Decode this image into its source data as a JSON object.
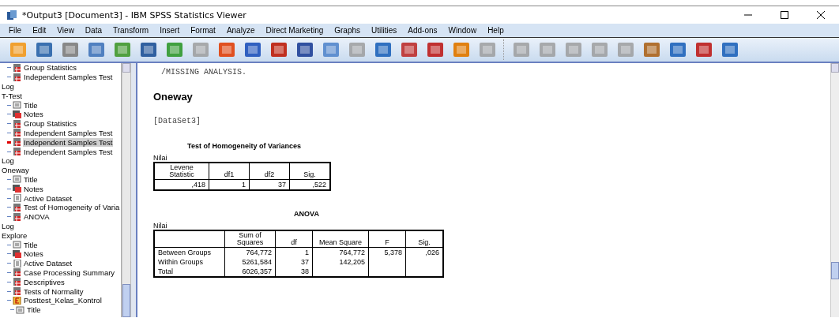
{
  "window": {
    "title": "*Output3 [Document3] - IBM SPSS Statistics Viewer"
  },
  "menu": [
    "File",
    "Edit",
    "View",
    "Data",
    "Transform",
    "Insert",
    "Format",
    "Analyze",
    "Direct Marketing",
    "Graphs",
    "Utilities",
    "Add-ons",
    "Window",
    "Help"
  ],
  "outline": [
    {
      "label": "Group Statistics",
      "kind": "table",
      "selected": false
    },
    {
      "label": "Independent Samples Test",
      "kind": "table",
      "selected": false
    },
    {
      "label": "Log",
      "kind": "log",
      "selected": false
    },
    {
      "label": "T-Test",
      "kind": "heading",
      "selected": false,
      "children": [
        {
          "label": "Title",
          "kind": "title",
          "selected": false
        },
        {
          "label": "Notes",
          "kind": "notes",
          "selected": false
        },
        {
          "label": "Group Statistics",
          "kind": "table",
          "selected": false
        },
        {
          "label": "Independent Samples Test",
          "kind": "table",
          "selected": false
        },
        {
          "label": "Independent Samples Test",
          "kind": "table",
          "selected": true
        },
        {
          "label": "Independent Samples Test",
          "kind": "table",
          "selected": false
        }
      ]
    },
    {
      "label": "Log",
      "kind": "log",
      "selected": false
    },
    {
      "label": "Oneway",
      "kind": "heading",
      "selected": false,
      "children": [
        {
          "label": "Title",
          "kind": "title",
          "selected": false
        },
        {
          "label": "Notes",
          "kind": "notes",
          "selected": false
        },
        {
          "label": "Active Dataset",
          "kind": "text",
          "selected": false
        },
        {
          "label": "Test of Homogeneity of Varia",
          "kind": "table",
          "selected": false
        },
        {
          "label": "ANOVA",
          "kind": "table",
          "selected": false
        }
      ]
    },
    {
      "label": "Log",
      "kind": "log",
      "selected": false
    },
    {
      "label": "Explore",
      "kind": "heading",
      "selected": false,
      "children": [
        {
          "label": "Title",
          "kind": "title",
          "selected": false
        },
        {
          "label": "Notes",
          "kind": "notes",
          "selected": false
        },
        {
          "label": "Active Dataset",
          "kind": "text",
          "selected": false
        },
        {
          "label": "Case Processing Summary",
          "kind": "table",
          "selected": false
        },
        {
          "label": "Descriptives",
          "kind": "table",
          "selected": false
        },
        {
          "label": "Tests of Normality",
          "kind": "table",
          "selected": false
        },
        {
          "label": "Posttest_Kelas_Kontrol",
          "kind": "group",
          "selected": false,
          "children": [
            {
              "label": "Title",
              "kind": "title",
              "selected": false
            }
          ]
        }
      ]
    }
  ],
  "output": {
    "syntax_line": "/MISSING ANALYSIS.",
    "heading": "Oneway",
    "dataset": "[DataSet3]",
    "homogeneity": {
      "title": "Test of Homogeneity of Variances",
      "variable": "Nilai",
      "columns": [
        "Levene Statistic",
        "df1",
        "df2",
        "Sig."
      ],
      "rows": [
        [
          ",418",
          "1",
          "37",
          ",522"
        ]
      ]
    },
    "anova": {
      "title": "ANOVA",
      "variable": "Nilai",
      "columns": [
        "",
        "Sum of Squares",
        "df",
        "Mean Square",
        "F",
        "Sig."
      ],
      "rows": [
        [
          "Between Groups",
          "764,772",
          "1",
          "764,772",
          "5,378",
          ",026"
        ],
        [
          "Within Groups",
          "5261,584",
          "37",
          "142,205",
          "",
          ""
        ],
        [
          "Total",
          "6026,357",
          "38",
          "",
          "",
          ""
        ]
      ]
    }
  }
}
